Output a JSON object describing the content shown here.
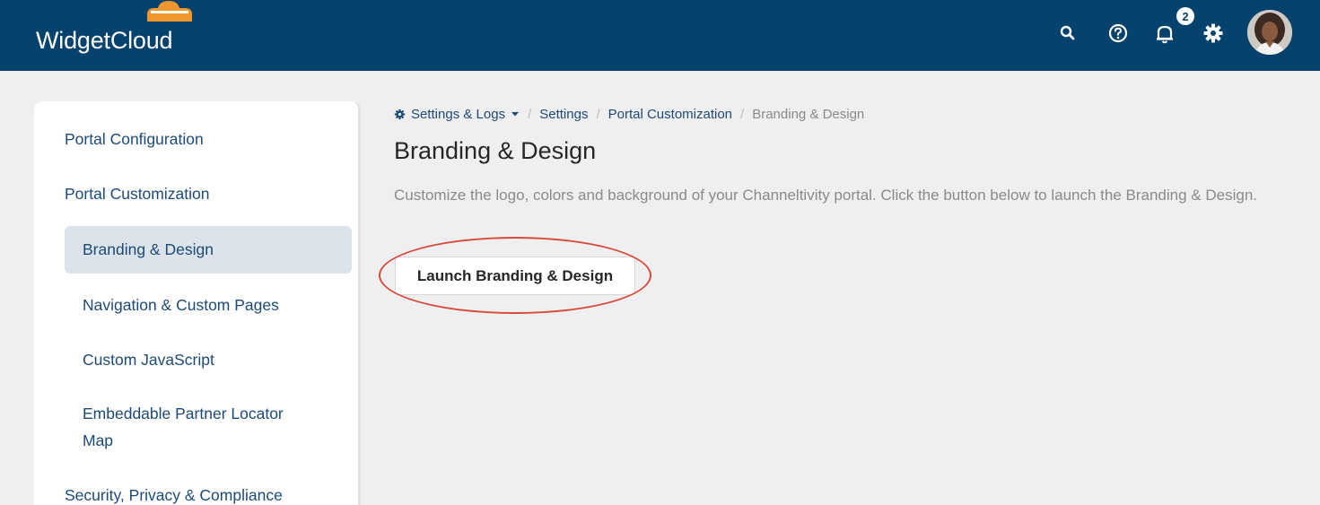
{
  "header": {
    "app_name": "WidgetCloud",
    "notification_count": "2",
    "icons": [
      "cloud-logo-icon",
      "search-icon",
      "help-icon",
      "bell-icon",
      "gear-icon",
      "avatar"
    ],
    "brand_color": "#05426e",
    "logo_accent": "#f0962e"
  },
  "sidebar": {
    "items": [
      {
        "label": "Portal Configuration",
        "level": "top"
      },
      {
        "label": "Portal Customization",
        "level": "top"
      },
      {
        "label": "Branding & Design",
        "level": "sub",
        "active": true
      },
      {
        "label": "Navigation & Custom Pages",
        "level": "sub"
      },
      {
        "label": "Custom JavaScript",
        "level": "sub"
      },
      {
        "label": "Embeddable Partner Locator",
        "level": "sub"
      },
      {
        "label": "Map",
        "level": "sub"
      },
      {
        "label": "Security, Privacy & Compliance",
        "level": "top"
      }
    ]
  },
  "breadcrumb": {
    "root": "Settings & Logs",
    "items": [
      "Settings",
      "Portal Customization"
    ],
    "current": "Branding & Design"
  },
  "main": {
    "title": "Branding & Design",
    "description": "Customize the logo, colors and background of your Channeltivity portal. Click the button below to launch the Branding & Design.",
    "launch_button": "Launch Branding & Design",
    "highlight_color": "#d84a3a"
  }
}
